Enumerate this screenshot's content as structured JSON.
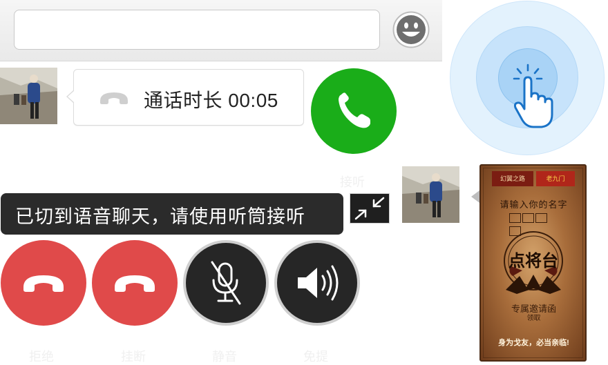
{
  "input_bar": {
    "text_value": "",
    "emoji_icon": "smiley-icon"
  },
  "call_log": {
    "text": "通话时长 00:05",
    "icon": "hangup-icon"
  },
  "answer": {
    "icon": "phone-icon",
    "color": "#1aad19"
  },
  "toast": {
    "text": "已切到语音聊天，请使用听筒接听"
  },
  "faint_labels": {
    "answer_label": "接听",
    "reject_label": "拒绝",
    "hangup_label": "挂断",
    "mute_label": "静音",
    "speaker_label": "免提"
  },
  "buttons": {
    "reject": {
      "icon": "hangup-icon",
      "color": "#e04a4a"
    },
    "hangup": {
      "icon": "hangup-icon",
      "color": "#e04a4a"
    },
    "mute": {
      "icon": "mic-off-icon"
    },
    "speaker": {
      "icon": "speaker-icon"
    },
    "minimize": {
      "icon": "minimize-arrows-icon"
    }
  },
  "invitation_card": {
    "logo_left": "幻翼之路",
    "logo_right": "老九门",
    "prompt": "请输入你的名字",
    "seal_text": "点将台",
    "subtitle": "专属邀请函",
    "claim": "领取",
    "bottom": "身为戈友，必当亲临!"
  },
  "colors": {
    "ripple": "#a9d3f6",
    "toast_bg": "#2b2b2b",
    "card_brown": "#a86d3b"
  }
}
